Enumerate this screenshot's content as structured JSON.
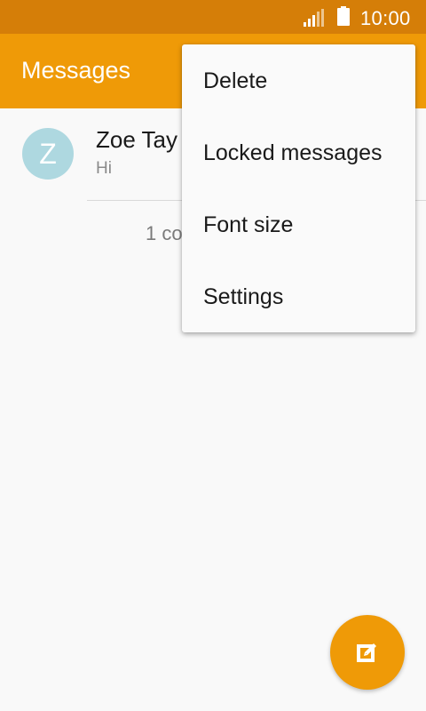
{
  "status_bar": {
    "time": "10:00",
    "icons": [
      "signal-icon",
      "battery-icon"
    ]
  },
  "app_bar": {
    "title": "Messages"
  },
  "conversation": {
    "avatar_letter": "Z",
    "name": "Zoe Tay",
    "preview": "Hi",
    "count_text": "1 co"
  },
  "overflow_menu": {
    "items": [
      {
        "label": "Delete"
      },
      {
        "label": "Locked messages"
      },
      {
        "label": "Font size"
      },
      {
        "label": "Settings"
      }
    ]
  },
  "fab": {
    "icon": "compose-icon"
  },
  "colors": {
    "status_bar": "#d57e08",
    "app_bar": "#ef9a07",
    "avatar": "#aed8e0",
    "background": "#f9f9f9"
  }
}
